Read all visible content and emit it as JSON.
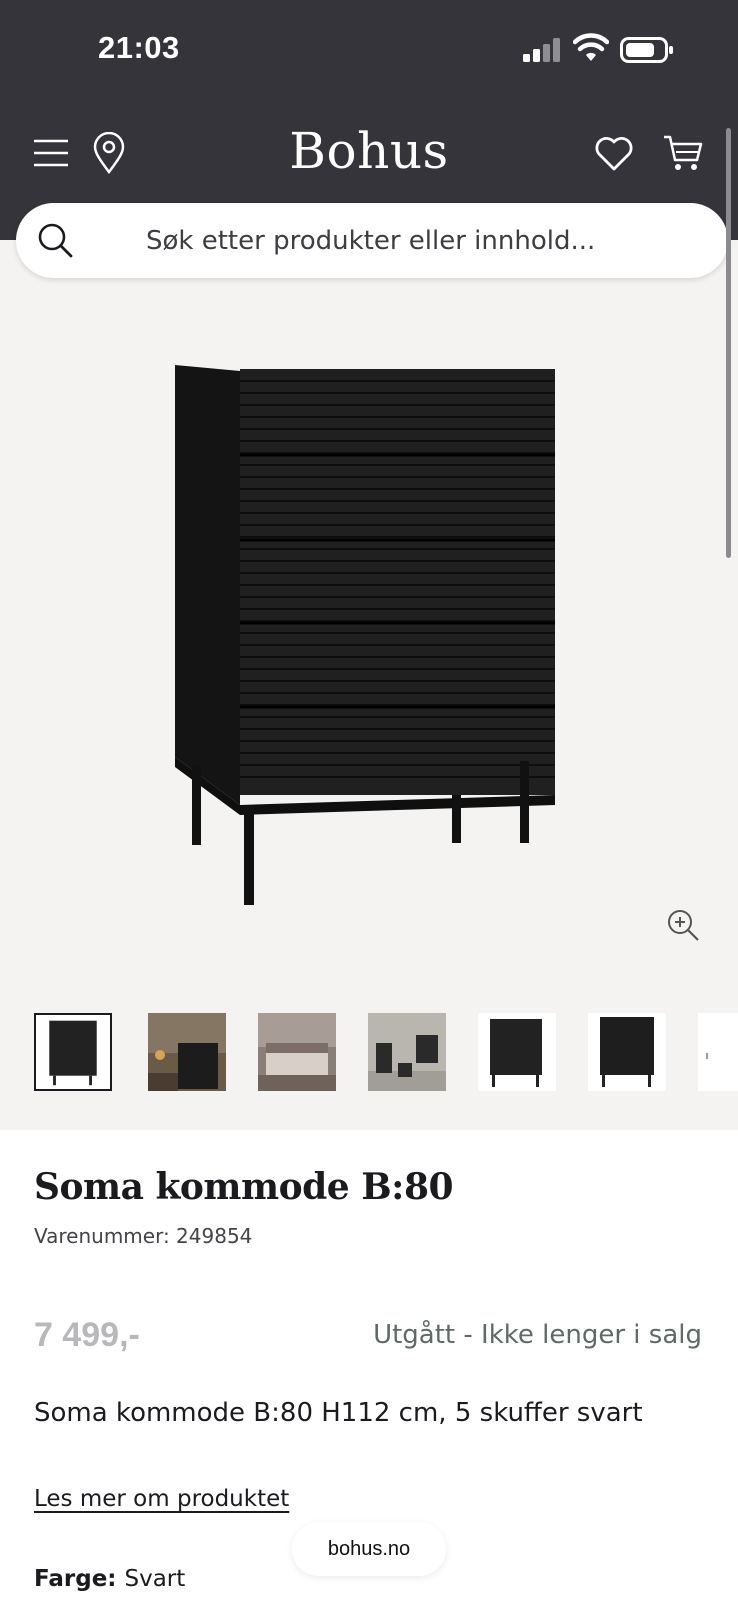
{
  "status_bar": {
    "time": "21:03"
  },
  "header": {
    "logo": "Bohus",
    "icons": [
      "menu-icon",
      "location-pin-icon",
      "heart-icon",
      "cart-icon"
    ],
    "background": "#35343a"
  },
  "search": {
    "placeholder": "Søk etter produkter eller innhold..."
  },
  "gallery": {
    "background": "#f4f3f1",
    "thumbnails": [
      "thumbnail-front-black",
      "thumbnail-room-wood",
      "thumbnail-bedroom",
      "thumbnail-concrete-room",
      "thumbnail-front-black-2",
      "thumbnail-front-black-3",
      "thumbnail-partial"
    ],
    "selected_index": 0
  },
  "product": {
    "title": "Soma kommode B:80",
    "sku_text": "Varenummer: 249854",
    "price": "7 499,-",
    "availability": "Utgått - Ikke lenger i salg",
    "description": "Soma kommode B:80 H112 cm, 5 skuffer svart",
    "read_more": "Les mer om produktet",
    "color_label": "Farge:",
    "color_value": "Svart"
  },
  "browser": {
    "url": "bohus.no"
  }
}
